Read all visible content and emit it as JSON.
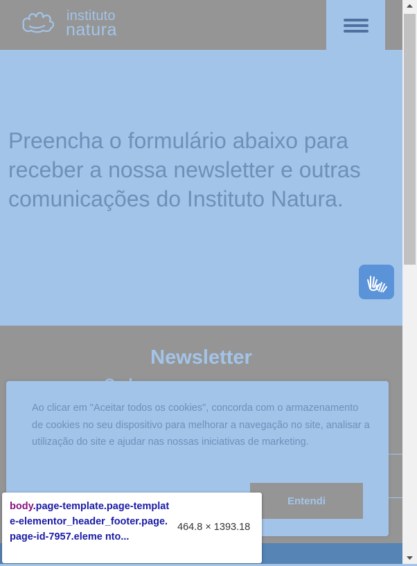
{
  "header": {
    "logo_top": "instituto",
    "logo_bottom": "natura",
    "menu_icon": "hamburger-menu-icon"
  },
  "hero": {
    "heading": "Preencha o formulário abaixo para receber a nossa newsletter e outras comunicações do Instituto Natura.",
    "accessibility_icon": "sign-language-hands-icon"
  },
  "newsletter": {
    "title": "Newsletter",
    "partial_text": "Cad"
  },
  "cookie_banner": {
    "text": "Ao clicar em \"Aceitar todos os cookies\", concorda com o armazenamento de cookies no seu dispositivo para melhorar a navegação no site, analisar a utilização do site e ajudar nas nossas iniciativas de marketing.",
    "accept_button": "Entendi"
  },
  "devtools_tooltip": {
    "tag": "body",
    "selector": ".page-template.page-template-elementor_header_footer.page.page-id-7957.eleme nto...",
    "size": "464.8 × 1393.18"
  },
  "colors": {
    "overlay_blue": "#a3c4e9",
    "overlay_gray": "#959595",
    "text_blue": "#6e8fb8",
    "accent_button": "#5b93d9"
  }
}
